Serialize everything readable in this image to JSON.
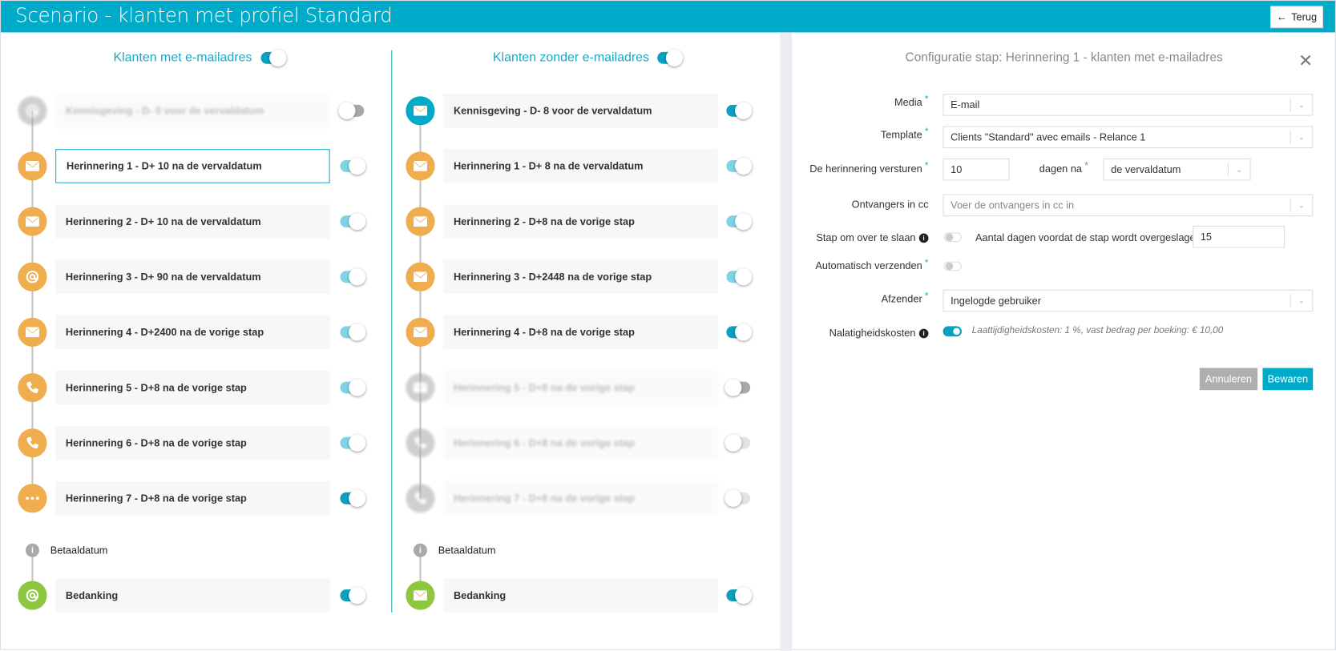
{
  "header": {
    "title": "Scenario - klanten met profiel Standard",
    "back_label": "Terug",
    "back_icon": "arrow-left-icon"
  },
  "colors": {
    "brand": "#00abc9",
    "orange": "#f0ad4e",
    "green": "#8dc63f",
    "disabled": "#a9a9a9"
  },
  "left": {
    "title": "Klanten met e-mailadres",
    "enabled": true,
    "steps": [
      {
        "label": "Kennisgeving - D- 0 voor de vervaldatum",
        "icon": "at",
        "color": "disabled",
        "toggle": "off",
        "blur": true
      },
      {
        "label": "Herinnering 1 - D+ 10 na de vervaldatum",
        "icon": "envelope",
        "color": "orange",
        "toggle": "light",
        "selected": true
      },
      {
        "label": "Herinnering 2 - D+ 10 na de vervaldatum",
        "icon": "envelope",
        "color": "orange",
        "toggle": "light"
      },
      {
        "label": "Herinnering 3 - D+ 90 na de vervaldatum",
        "icon": "at",
        "color": "orange",
        "toggle": "light"
      },
      {
        "label": "Herinnering 4 - D+2400 na de vorige stap",
        "icon": "envelope",
        "color": "orange",
        "toggle": "light"
      },
      {
        "label": "Herinnering 5 - D+8 na de vorige stap",
        "icon": "phone",
        "color": "orange",
        "toggle": "light"
      },
      {
        "label": "Herinnering 6 - D+8 na de vorige stap",
        "icon": "phone",
        "color": "orange",
        "toggle": "light"
      },
      {
        "label": "Herinnering 7 - D+8 na de vorige stap",
        "icon": "dots",
        "color": "orange",
        "toggle": "on"
      }
    ],
    "payment_label": "Betaaldatum",
    "thanks": {
      "label": "Bedanking",
      "icon": "at",
      "color": "green",
      "toggle": "on"
    }
  },
  "right": {
    "title": "Klanten zonder e-mailadres",
    "enabled": true,
    "steps": [
      {
        "label": "Kennisgeving - D- 8 voor de vervaldatum",
        "icon": "envelope",
        "color": "brand",
        "toggle": "on"
      },
      {
        "label": "Herinnering 1 - D+ 8 na de vervaldatum",
        "icon": "envelope",
        "color": "orange",
        "toggle": "light"
      },
      {
        "label": "Herinnering 2 - D+8 na de vorige stap",
        "icon": "envelope",
        "color": "orange",
        "toggle": "light"
      },
      {
        "label": "Herinnering 3 - D+2448 na de vorige stap",
        "icon": "envelope",
        "color": "orange",
        "toggle": "light"
      },
      {
        "label": "Herinnering 4 - D+8 na de vorige stap",
        "icon": "envelope",
        "color": "orange",
        "toggle": "on"
      },
      {
        "label": "Herinnering 5 - D+8 na de vorige stap",
        "icon": "envelope",
        "color": "disabled",
        "toggle": "off",
        "blur": true
      },
      {
        "label": "Herinnering 6 - D+8 na de vorige stap",
        "icon": "phone",
        "color": "disabled",
        "toggle": "offl",
        "blur": true
      },
      {
        "label": "Herinnering 7 - D+8 na de vorige stap",
        "icon": "phone",
        "color": "disabled",
        "toggle": "offl",
        "blur": true
      }
    ],
    "payment_label": "Betaaldatum",
    "thanks": {
      "label": "Bedanking",
      "icon": "envelope",
      "color": "green",
      "toggle": "on"
    }
  },
  "config": {
    "title": "Configuratie stap: Herinnering 1 - klanten met e-mailadres",
    "media_label": "Media",
    "media_value": "E-mail",
    "template_label": "Template",
    "template_value": "Clients \"Standard\" avec emails - Relance 1",
    "send_label": "De herinnering versturen",
    "send_value": "10",
    "days_after_label": "dagen na",
    "days_after_value": "de vervaldatum",
    "cc_label": "Ontvangers in cc",
    "cc_placeholder": "Voer de ontvangers in cc in",
    "skip_label": "Stap om over te slaan",
    "skip_enabled": false,
    "skip_days_label": "Aantal dagen voordat de stap wordt overgeslagen",
    "skip_days_value": "15",
    "auto_label": "Automatisch verzenden",
    "auto_enabled": false,
    "sender_label": "Afzender",
    "sender_value": "Ingelogde gebruiker",
    "fees_label": "Nalatigheidskosten",
    "fees_enabled": true,
    "fees_note": "Laattijdigheidskosten: 1 %, vast bedrag per boeking: € 10,00",
    "cancel_label": "Annuleren",
    "save_label": "Bewaren"
  }
}
